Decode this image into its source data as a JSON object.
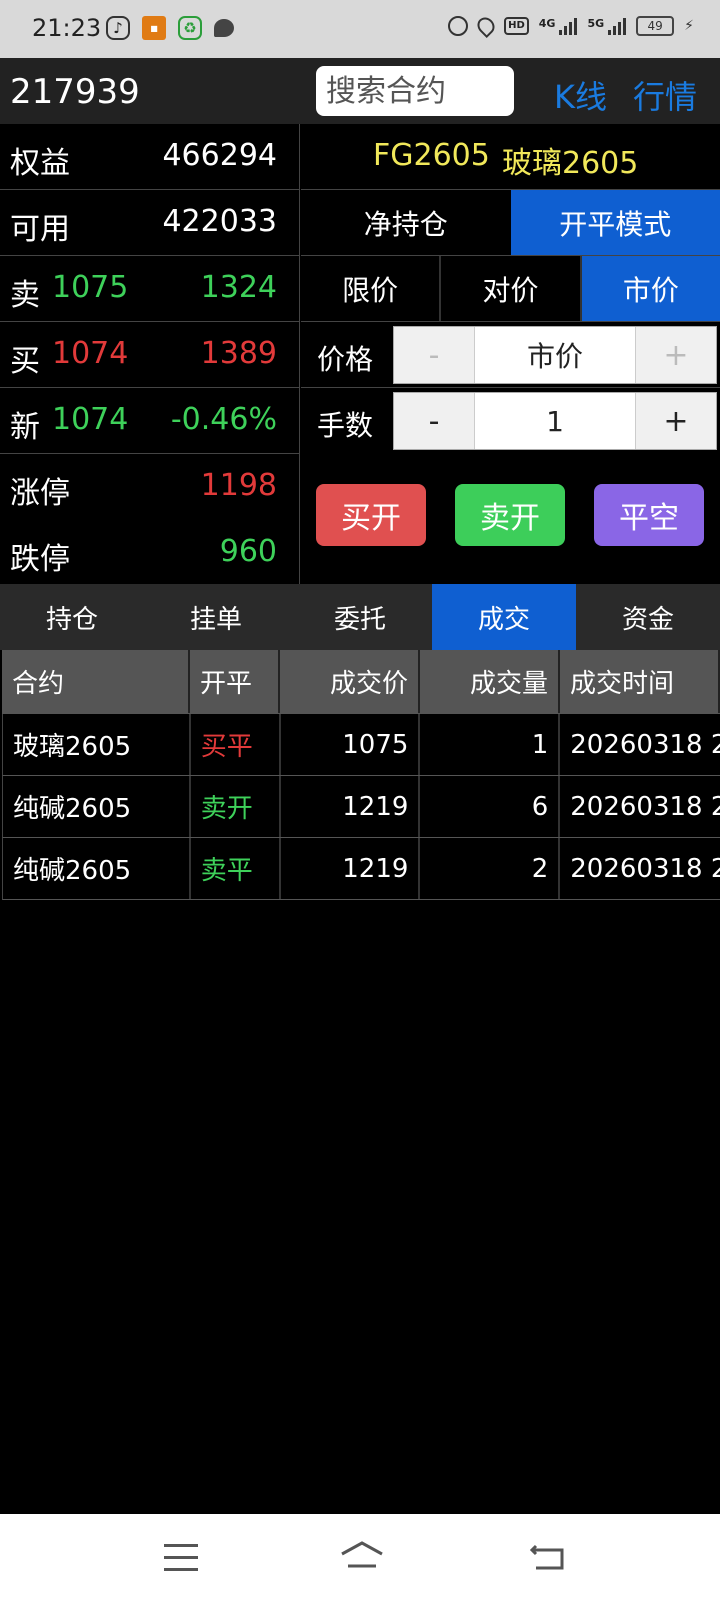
{
  "status_bar": {
    "time": "21:23",
    "network_1": "4G",
    "network_2": "5G",
    "hd": "HD",
    "battery": "49"
  },
  "header": {
    "account": "217939",
    "search_placeholder": "搜索合约",
    "kline_label": "K线",
    "market_label": "行情"
  },
  "info": {
    "equity_label": "权益",
    "equity_value": "466294",
    "available_label": "可用",
    "available_value": "422033",
    "ask_label": "卖",
    "ask_price": "1075",
    "ask_volume": "1324",
    "bid_label": "买",
    "bid_price": "1074",
    "bid_volume": "1389",
    "last_label": "新",
    "last_price": "1074",
    "change": "-0.46%",
    "limit_up_label": "涨停",
    "limit_up_value": "1198",
    "limit_down_label": "跌停",
    "limit_down_value": "960"
  },
  "panel": {
    "contract_code": "FG2605",
    "contract_name": "玻璃2605",
    "mode_net": "净持仓",
    "mode_open_close": "开平模式",
    "type_limit": "限价",
    "type_counter": "对价",
    "type_market": "市价",
    "price_label": "价格",
    "price_minus": "-",
    "price_value": "市价",
    "price_plus": "+",
    "qty_label": "手数",
    "qty_minus": "-",
    "qty_value": "1",
    "qty_plus": "+",
    "buy_open": "买开",
    "sell_open": "卖开",
    "close_short": "平空"
  },
  "tabs": [
    "持仓",
    "挂单",
    "委托",
    "成交",
    "资金"
  ],
  "table": {
    "headers": [
      "合约",
      "开平",
      "成交价",
      "成交量",
      "成交时间"
    ],
    "rows": [
      {
        "contract": "玻璃2605",
        "side": "买平",
        "price": "1075",
        "volume": "1",
        "time": "20260318 2"
      },
      {
        "contract": "纯碱2605",
        "side": "卖开",
        "price": "1219",
        "volume": "6",
        "time": "20260318 2"
      },
      {
        "contract": "纯碱2605",
        "side": "卖平",
        "price": "1219",
        "volume": "2",
        "time": "20260318 2"
      }
    ]
  },
  "colors": {
    "accent_blue": "#0f5fd1",
    "up_red": "#e23a3a",
    "down_green": "#3ed15a",
    "contract_yellow": "#f1e85a"
  }
}
